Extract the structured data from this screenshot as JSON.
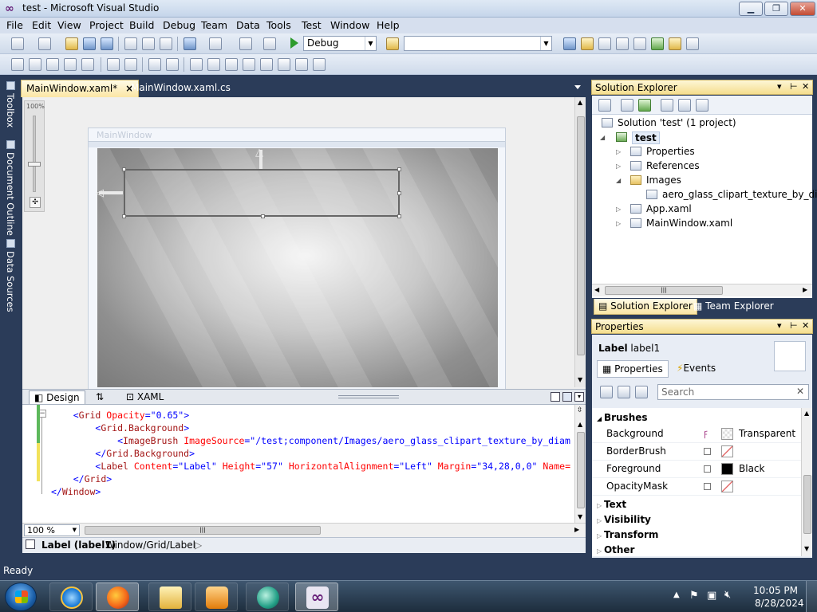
{
  "window": {
    "title": "test - Microsoft Visual Studio",
    "min": "0",
    "max": "1",
    "close": "r"
  },
  "menu": [
    "File",
    "Edit",
    "View",
    "Project",
    "Build",
    "Debug",
    "Team",
    "Data",
    "Tools",
    "Test",
    "Window",
    "Help"
  ],
  "toolbar": {
    "config": "Debug",
    "platform": ""
  },
  "left_dock": {
    "toolbox": "Toolbox",
    "document_outline": "Document Outline",
    "data_sources": "Data Sources"
  },
  "doc_tabs": [
    {
      "label": "MainWindow.xaml*",
      "close": "×"
    },
    {
      "label": "MainWindow.xaml.cs"
    }
  ],
  "designer": {
    "zoom_label": "100%",
    "window_title": "MainWindow"
  },
  "split": {
    "design_tab": "Design",
    "swap": "⇅",
    "xaml_tab": "XAML"
  },
  "code_lines": [
    {
      "indent": "    ",
      "parts": [
        {
          "c": "pn",
          "t": "<"
        },
        {
          "c": "kw",
          "t": "Grid"
        },
        {
          "c": "at",
          "t": " Opacity"
        },
        {
          "c": "pn",
          "t": "=\""
        },
        {
          "c": "vl",
          "t": "0.65"
        },
        {
          "c": "pn",
          "t": "\">"
        }
      ]
    },
    {
      "indent": "        ",
      "parts": [
        {
          "c": "pn",
          "t": "<"
        },
        {
          "c": "kw",
          "t": "Grid.Background"
        },
        {
          "c": "pn",
          "t": ">"
        }
      ]
    },
    {
      "indent": "            ",
      "parts": [
        {
          "c": "pn",
          "t": "<"
        },
        {
          "c": "kw",
          "t": "ImageBrush"
        },
        {
          "c": "at",
          "t": " ImageSource"
        },
        {
          "c": "pn",
          "t": "=\""
        },
        {
          "c": "vl",
          "t": "/test;component/Images/aero_glass_clipart_texture_by_diam"
        }
      ]
    },
    {
      "indent": "        ",
      "parts": [
        {
          "c": "pn",
          "t": "</"
        },
        {
          "c": "kw",
          "t": "Grid.Background"
        },
        {
          "c": "pn",
          "t": ">"
        }
      ]
    },
    {
      "indent": "        ",
      "parts": [
        {
          "c": "pn",
          "t": "<"
        },
        {
          "c": "kw",
          "t": "Label"
        },
        {
          "c": "at",
          "t": " Content"
        },
        {
          "c": "pn",
          "t": "=\""
        },
        {
          "c": "vl",
          "t": "Label"
        },
        {
          "c": "pn",
          "t": "\""
        },
        {
          "c": "at",
          "t": " Height"
        },
        {
          "c": "pn",
          "t": "=\""
        },
        {
          "c": "vl",
          "t": "57"
        },
        {
          "c": "pn",
          "t": "\""
        },
        {
          "c": "at",
          "t": " HorizontalAlignment"
        },
        {
          "c": "pn",
          "t": "=\""
        },
        {
          "c": "vl",
          "t": "Left"
        },
        {
          "c": "pn",
          "t": "\""
        },
        {
          "c": "at",
          "t": " Margin"
        },
        {
          "c": "pn",
          "t": "=\""
        },
        {
          "c": "vl",
          "t": "34,28,0,0"
        },
        {
          "c": "pn",
          "t": "\""
        },
        {
          "c": "at",
          "t": " Name="
        }
      ]
    },
    {
      "indent": "    ",
      "parts": [
        {
          "c": "pn",
          "t": "</"
        },
        {
          "c": "kw",
          "t": "Grid"
        },
        {
          "c": "pn",
          "t": ">"
        }
      ]
    },
    {
      "indent": "",
      "parts": [
        {
          "c": "pn",
          "t": "</"
        },
        {
          "c": "kw",
          "t": "Window"
        },
        {
          "c": "pn",
          "t": ">"
        }
      ]
    }
  ],
  "editor": {
    "zoom": "100 %",
    "thumb": "|||"
  },
  "breadcrumb": {
    "element": "Label (label1)",
    "path": "Window/Grid/Label",
    "arrow": "▷"
  },
  "solution_explorer": {
    "title": "Solution Explorer",
    "items": [
      {
        "label": "Solution 'test' (1 project)"
      },
      {
        "label": "test"
      },
      {
        "label": "Properties"
      },
      {
        "label": "References"
      },
      {
        "label": "Images"
      },
      {
        "label": "aero_glass_clipart_texture_by_diamo"
      },
      {
        "label": "App.xaml"
      },
      {
        "label": "MainWindow.xaml"
      }
    ],
    "tabs": [
      "Solution Explorer",
      "Team Explorer"
    ]
  },
  "properties": {
    "title": "Properties",
    "type": "Label",
    "name": "label1",
    "tabs": [
      "Properties",
      "Events"
    ],
    "search_placeholder": "Search",
    "category_brushes": "Brushes",
    "rows": [
      {
        "name": "Background",
        "value": "Transparent"
      },
      {
        "name": "BorderBrush",
        "value": ""
      },
      {
        "name": "Foreground",
        "value": "Black"
      },
      {
        "name": "OpacityMask",
        "value": ""
      }
    ],
    "categories": [
      "Text",
      "Visibility",
      "Transform",
      "Other"
    ]
  },
  "status": {
    "text": "Ready"
  },
  "taskbar": {
    "time": "10:05 PM",
    "date": "8/28/2024"
  }
}
